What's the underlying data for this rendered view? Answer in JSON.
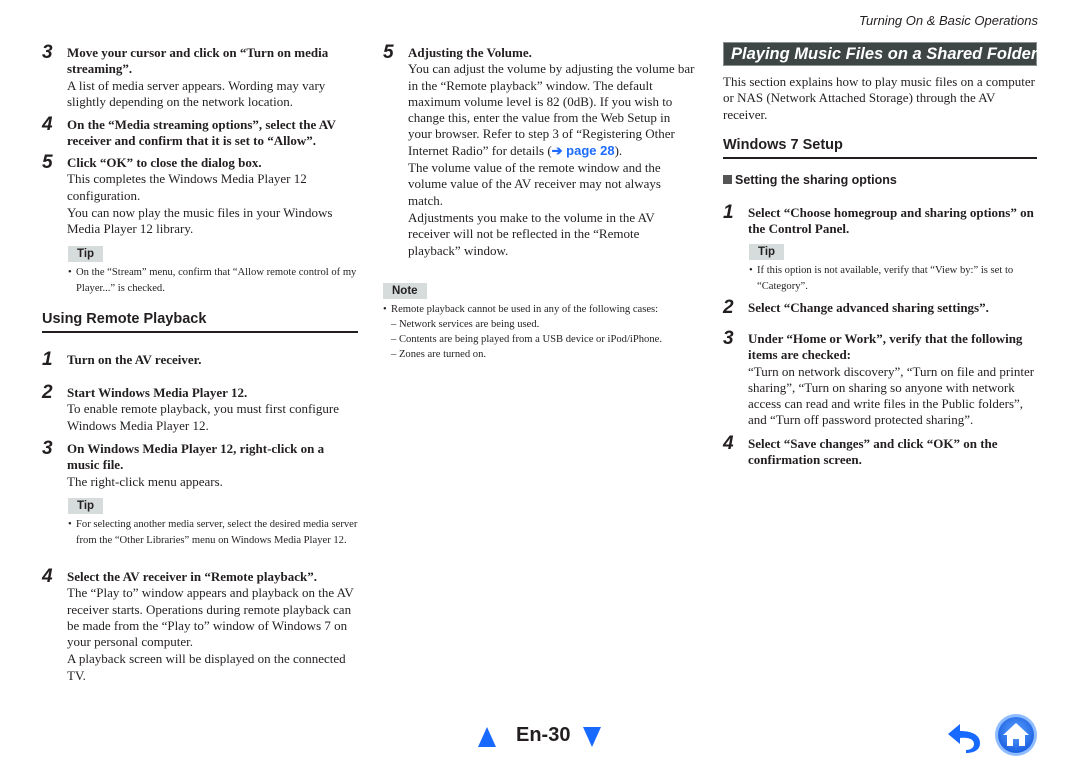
{
  "header": {
    "running_head": "Turning On & Basic Operations"
  },
  "col1": {
    "steps_top": [
      {
        "num": "3",
        "title": "Move your cursor and click on “Turn on media streaming”.",
        "texts": [
          "A list of media server appears. Wording may vary slightly depending on the network location."
        ]
      },
      {
        "num": "4",
        "title": "On the “Media streaming options”, select the AV receiver and confirm that it is set to “Allow”.",
        "texts": []
      },
      {
        "num": "5",
        "title": "Click “OK” to close the dialog box.",
        "texts": [
          "This completes the Windows Media Player 12 configuration.",
          "You can now play the music files in your Windows Media Player 12 library."
        ]
      }
    ],
    "tip1": {
      "label": "Tip",
      "text": "On the “Stream” menu, confirm that “Allow remote control of my Player...” is checked."
    },
    "section_heading": "Using Remote Playback",
    "steps_bottom": [
      {
        "num": "1",
        "title": "Turn on the AV receiver.",
        "texts": []
      },
      {
        "num": "2",
        "title": "Start Windows Media Player 12.",
        "texts": [
          "To enable remote playback, you must first configure Windows Media Player 12."
        ]
      },
      {
        "num": "3",
        "title": "On Windows Media Player 12, right-click on a music file.",
        "texts": [
          "The right-click menu appears."
        ]
      },
      {
        "num": "4",
        "title": "Select the AV receiver in “Remote playback”.",
        "texts": [
          "The “Play to” window appears and playback on the AV receiver starts. Operations during remote playback can be made from the “Play to” window of Windows 7 on your personal computer.",
          "A playback screen will be displayed on the connected TV."
        ]
      }
    ],
    "tip2": {
      "label": "Tip",
      "text": "For selecting another media server, select the desired media server from the “Other Libraries” menu on Windows Media Player 12."
    }
  },
  "col2": {
    "step5": {
      "num": "5",
      "title": "Adjusting the Volume.",
      "text1_before_link": "You can adjust the volume by adjusting the volume bar in the “Remote playback” window. The default maximum volume level is 82 (0dB). If you wish to change this, enter the value from the Web Setup in your browser. Refer to step 3 of “Registering Other Internet Radio” for details (",
      "link_label": "➔ page 28",
      "text1_after_link": ").",
      "text2": "The volume value of the remote window and the volume value of the AV receiver may not always match.",
      "text3": "Adjustments you make to the volume in the AV receiver will not be reflected in the “Remote playback” window."
    },
    "note": {
      "label": "Note",
      "bullet": "Remote playback cannot be used in any of the following cases:",
      "items": [
        "– Network services are being used.",
        "– Contents are being played from a USB device or iPod/iPhone.",
        "– Zones are turned on."
      ]
    }
  },
  "col3": {
    "banner": "Playing Music Files on a Shared Folder",
    "intro": "This section explains how to play music files on a computer or NAS (Network Attached Storage) through the AV receiver.",
    "section_heading": "Windows 7 Setup",
    "sub_heading": "Setting the sharing options",
    "steps": [
      {
        "num": "1",
        "title": "Select “Choose homegroup and sharing options” on the Control Panel.",
        "texts": []
      },
      {
        "num": "2",
        "title": "Select “Change advanced sharing settings”.",
        "texts": []
      },
      {
        "num": "3",
        "title": "Under “Home or Work”, verify that the following items are checked:",
        "texts": [
          "“Turn on network discovery”, “Turn on file and printer sharing”, “Turn on sharing so anyone with network access can read and write files in the Public folders”, and “Turn off password protected sharing”."
        ]
      },
      {
        "num": "4",
        "title": "Select “Save changes” and click “OK” on the confirmation screen.",
        "texts": []
      }
    ],
    "tip": {
      "label": "Tip",
      "text": "If this option is not available, verify that “View by:” is set to “Category”."
    }
  },
  "footer": {
    "page_number": "En-30",
    "prev_icon": "triangle-up-icon",
    "next_icon": "triangle-down-icon",
    "back_icon": "return-arrow-icon",
    "home_icon": "home-icon"
  },
  "colors": {
    "link": "#1e6cff",
    "nav_blue": "#1769ff",
    "banner_bg": "#3d4545",
    "tip_bg": "#d6dcdc"
  }
}
